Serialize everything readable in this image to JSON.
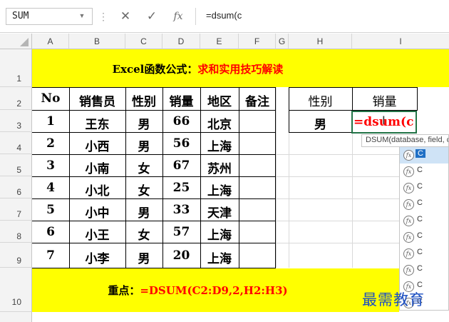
{
  "formula_bar": {
    "name_box": "SUM",
    "dots": "⋮",
    "cancel": "✕",
    "enter": "✓",
    "fx": "fx",
    "formula": "=dsum(c"
  },
  "columns": [
    "A",
    "B",
    "C",
    "D",
    "E",
    "F",
    "G",
    "H",
    "I"
  ],
  "rows": [
    "1",
    "2",
    "3",
    "4",
    "5",
    "6",
    "7",
    "8",
    "9",
    "10"
  ],
  "title": {
    "part1": "Excel函数公式：",
    "part2": "求和实用技巧解读"
  },
  "table": {
    "headers": [
      "No",
      "销售员",
      "性别",
      "销量",
      "地区",
      "备注"
    ],
    "rows": [
      [
        "1",
        "王东",
        "男",
        "66",
        "北京",
        ""
      ],
      [
        "2",
        "小西",
        "男",
        "56",
        "上海",
        ""
      ],
      [
        "3",
        "小南",
        "女",
        "67",
        "苏州",
        ""
      ],
      [
        "4",
        "小北",
        "女",
        "25",
        "上海",
        ""
      ],
      [
        "5",
        "小中",
        "男",
        "33",
        "天津",
        ""
      ],
      [
        "6",
        "小王",
        "女",
        "57",
        "上海",
        ""
      ],
      [
        "7",
        "小李",
        "男",
        "20",
        "上海",
        ""
      ]
    ]
  },
  "criteria": {
    "header_gender": "性别",
    "header_sales": "销量",
    "value_gender": "男",
    "editing_cell": "=dsum(c"
  },
  "tooltip": "DSUM(database, field, criteria)",
  "autocomplete_visible_letter": "C",
  "autocomplete_count": 10,
  "footer": {
    "label": "重点：",
    "formula": "=DSUM(C2:D9,2,H2:H3)"
  },
  "watermark": "最需教育",
  "colors": {
    "yellow": "#ffff00",
    "red": "#ff0000",
    "excel_green": "#217346",
    "watermark_blue": "#1c4fc1"
  }
}
